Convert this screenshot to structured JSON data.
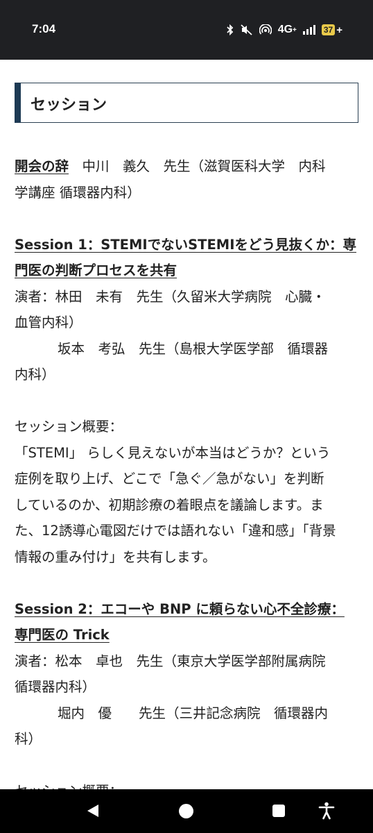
{
  "status_bar": {
    "time": "7:04",
    "network": "4G",
    "network_sup": "+",
    "battery": "37",
    "battery_plus": "+",
    "icons": [
      "bluetooth-icon",
      "mute-icon",
      "hotspot-icon",
      "signal-icon",
      "battery-icon"
    ]
  },
  "heading": "セッション",
  "opening": {
    "label": "開会の辞",
    "text_line1": "　中川　義久　先生（滋賀医科大学　内科",
    "text_line2": "学講座 循環器内科）"
  },
  "session1": {
    "title_line1": "Session 1：STEMIでないSTEMIをどう見抜くか：専",
    "title_line2": "門医の判断プロセスを共有",
    "speaker_line1": "演者：林田　未有　先生（久留米大学病院　心臓・",
    "speaker_line2": "血管内科）",
    "speaker2_line1": "坂本　考弘　先生（島根大学医学部　循環器",
    "speaker2_line2": "内科）",
    "summary_label": "セッション概要：",
    "summary_lines": [
      "「STEMI」 らしく見えないが本当はどうか？という",
      "症例を取り上げ、どこで「急ぐ／急がない」を判断",
      "しているのか、初期診療の着眼点を議論します。ま",
      "た、12誘導心電図だけでは語れない「違和感」「背景",
      "情報の重み付け」を共有します。"
    ]
  },
  "session2": {
    "title_line1": "Session 2：エコーや BNP に頼らない心不全診療：",
    "title_line2": "専門医の Trick",
    "speaker_line1": "演者：松本　卓也　先生（東京大学医学部附属病院",
    "speaker_line2": "循環器内科）",
    "speaker2_line1": "堀内　優　　先生（三井記念病院　循環器内",
    "speaker2_line2": "科）",
    "summary_label_partial": "セッション概要："
  },
  "colors": {
    "status_bg": "#1f2023",
    "heading_accent": "#1d3a54",
    "battery": "#e8c94a",
    "nav_bg": "#000000"
  },
  "nav": [
    "back-icon",
    "home-icon",
    "recents-icon",
    "accessibility-icon"
  ]
}
